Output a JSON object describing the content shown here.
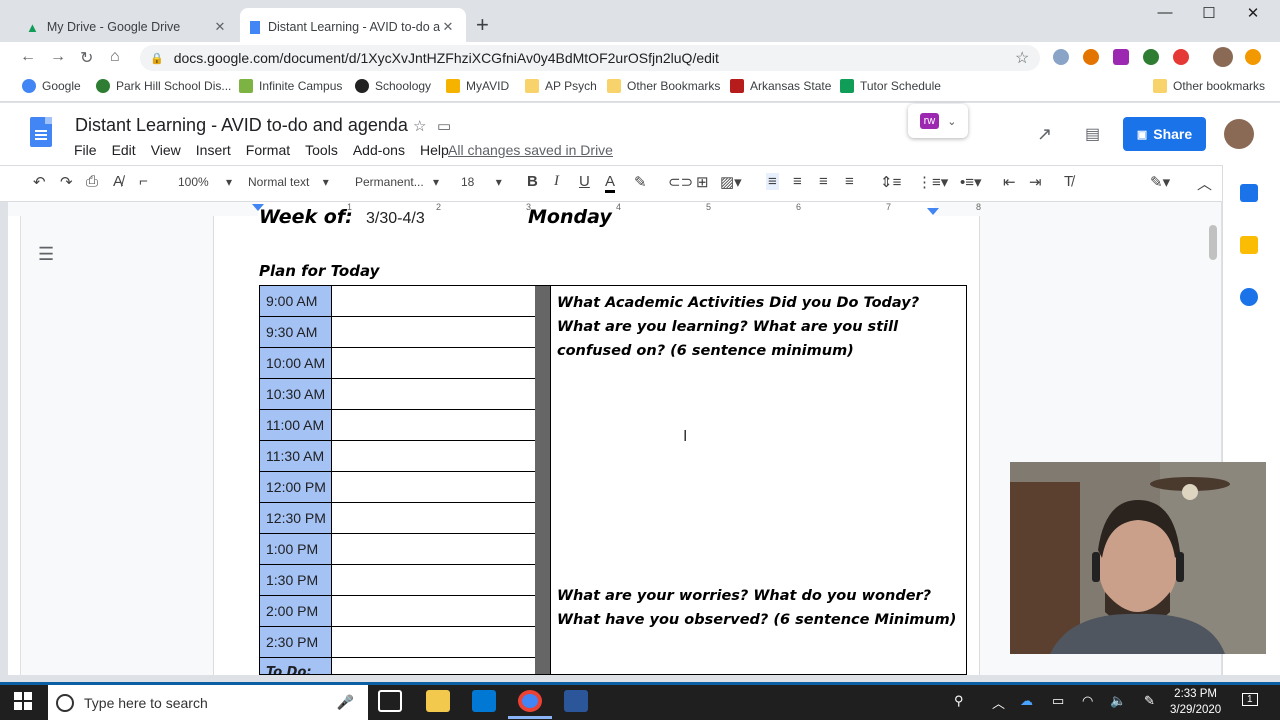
{
  "browser": {
    "tabs": [
      {
        "title": "My Drive - Google Drive"
      },
      {
        "title": "Distant Learning - AVID to-do an"
      }
    ],
    "url": "docs.google.com/document/d/1XycXvJntHZFhziXCGfniAv0y4BdMtOF2urOSfjn2luQ/edit",
    "bookmarks": [
      "Google",
      "Park Hill School Dis...",
      "Infinite Campus",
      "Schoology",
      "MyAVID",
      "AP Psych",
      "Other Bookmarks",
      "Arkansas State",
      "Tutor Schedule"
    ],
    "other_bookmarks": "Other bookmarks"
  },
  "docs": {
    "title": "Distant Learning - AVID to-do and agenda",
    "menus": [
      "File",
      "Edit",
      "View",
      "Insert",
      "Format",
      "Tools",
      "Add-ons",
      "Help"
    ],
    "save_status": "All changes saved in Drive",
    "share_label": "Share",
    "addon_label": "rw"
  },
  "toolbar": {
    "zoom": "100%",
    "style": "Normal text",
    "font": "Permanent...",
    "size": "18"
  },
  "ruler": {
    "numbers": [
      "1",
      "2",
      "3",
      "4",
      "5",
      "6",
      "7",
      "8"
    ]
  },
  "document": {
    "week_label": "Week of:",
    "week_value": "3/30-4/3",
    "day": "Monday",
    "plan_heading": "Plan for Today",
    "times": [
      "9:00 AM",
      "9:30 AM",
      "10:00 AM",
      "10:30 AM",
      "11:00 AM",
      "11:30 AM",
      "12:00 PM",
      "12:30 PM",
      "1:00 PM",
      "1:30 PM",
      "2:00 PM",
      "2:30 PM"
    ],
    "todo_label": "To Do:",
    "question1": "What Academic Activities Did you Do Today? What are you learning? What are you still confused on? (6 sentence minimum)",
    "question2": "What are your worries? What do you wonder? What have you observed? (6 sentence Minimum)"
  },
  "taskbar": {
    "search_placeholder": "Type here to search",
    "time": "2:33 PM",
    "date": "3/29/2020",
    "notification_count": "1"
  },
  "colors": {
    "time_cell": "#a4c2f4",
    "share": "#1a73e8",
    "taskbar": "#1f1f1f"
  }
}
